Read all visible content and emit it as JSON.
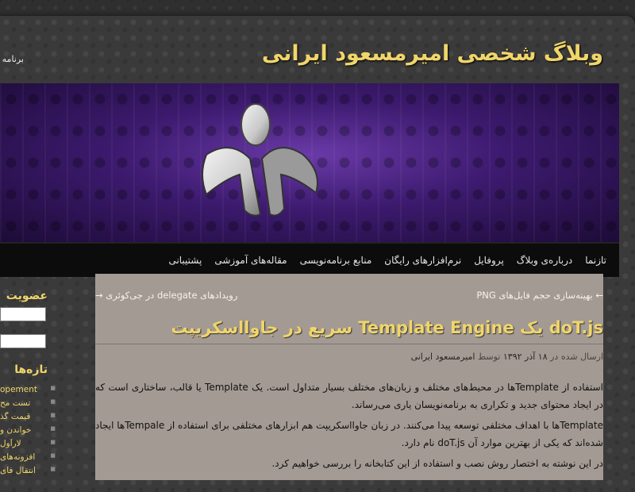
{
  "site": {
    "title": "وبلاگ شخصی امیرمسعود ایرانی",
    "top_link_cut": "برنامه‌"
  },
  "nav": {
    "items": [
      "تازنما",
      "درباره‌ی وبلاگ",
      "پروفایل",
      "نرم‌افزارهای رایگان",
      "منابع برنامه‌نویسی",
      "مقاله‌های آموزشی",
      "پشتیبانی"
    ]
  },
  "post_nav": {
    "next": "← بهینه‌سازی حجم فایل‌های PNG",
    "prev": "رویدادهای delegate در جی‌کوئری →"
  },
  "post": {
    "title": "doT.js یک Template Engine سریع در جاوااسکریپت",
    "meta_prefix": "ارسال شده در",
    "meta_date": "۱۸ آذر ۱۳۹۲",
    "meta_by": "توسط",
    "meta_author": "امیرمسعود ایرانی",
    "paragraphs": [
      "استفاده از Templateها در محیط‌های مختلف و زبان‌های مختلف بسیار متداول است. یک Template یا قالب، ساختاری است که در ایجاد محتوای جدید و تکراری به برنامه‌نویسان یاری می‌رساند.",
      "Templateها با اهداف مختلفی توسعه پیدا می‌کنند. در زبان جاوااسکریپت هم ابزارهای مختلفی برای استفاده از Tempaleها ایجاد شده‌اند که یکی از بهترین موارد آن doT.js نام دارد.",
      "در این نوشته به اختصار روش نصب و استفاده از این کتابخانه را بررسی خواهیم کرد."
    ]
  },
  "sidebar": {
    "membership_heading": "عضویت",
    "recent_heading": "تازه‌ها",
    "recent_items": [
      "opement",
      "تست مح",
      "قیمت گذ",
      "خواندن و",
      "لارآول",
      "افزونه‌های",
      "انتقال فای"
    ]
  },
  "colors": {
    "accent_yellow": "#f0d56a",
    "content_bg": "#a39a93",
    "nav_bg": "#0c0c0c",
    "banner_purple": "#3c1a6e"
  }
}
